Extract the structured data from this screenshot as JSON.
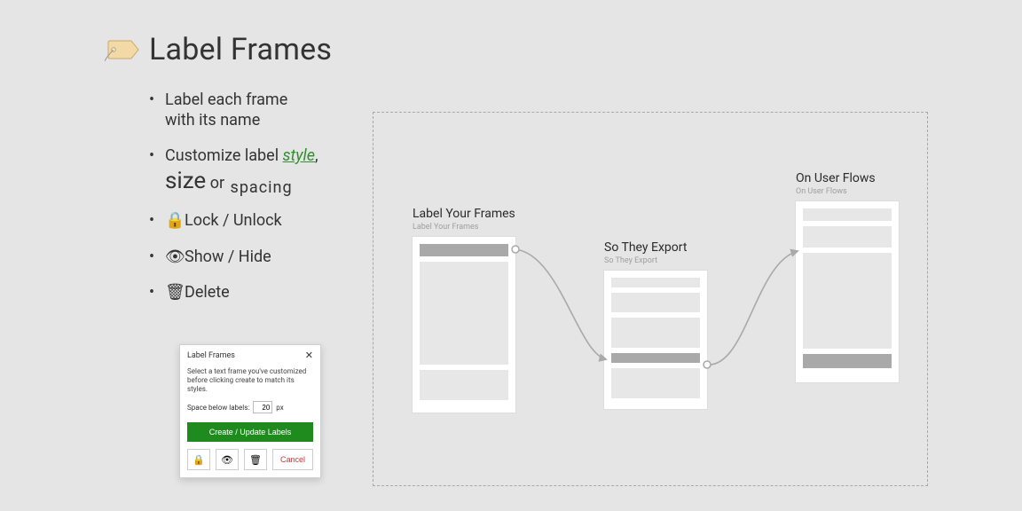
{
  "title": "Label Frames",
  "bullets": {
    "b1a": "Label each frame",
    "b1b": "with its name",
    "b2a": "Customize label ",
    "b2_style": "style",
    "b2_comma": ",",
    "b2_size": "size",
    "b2_or": " or ",
    "b2_spacing": "spacing",
    "b3": "Lock / Unlock",
    "b4": "Show / Hide",
    "b5": "Delete"
  },
  "dialog": {
    "title": "Label Frames",
    "description": "Select a text frame you've customized before clicking create to match its styles.",
    "spacing_label": "Space below labels:",
    "spacing_value": "20",
    "spacing_unit": "px",
    "primary": "Create / Update Labels",
    "cancel": "Cancel"
  },
  "frames": {
    "a": {
      "label": "Label Your Frames",
      "sub": "Label Your Frames"
    },
    "b": {
      "label": "So They Export",
      "sub": "So They Export"
    },
    "c": {
      "label": "On User Flows",
      "sub": "On User Flows"
    }
  }
}
